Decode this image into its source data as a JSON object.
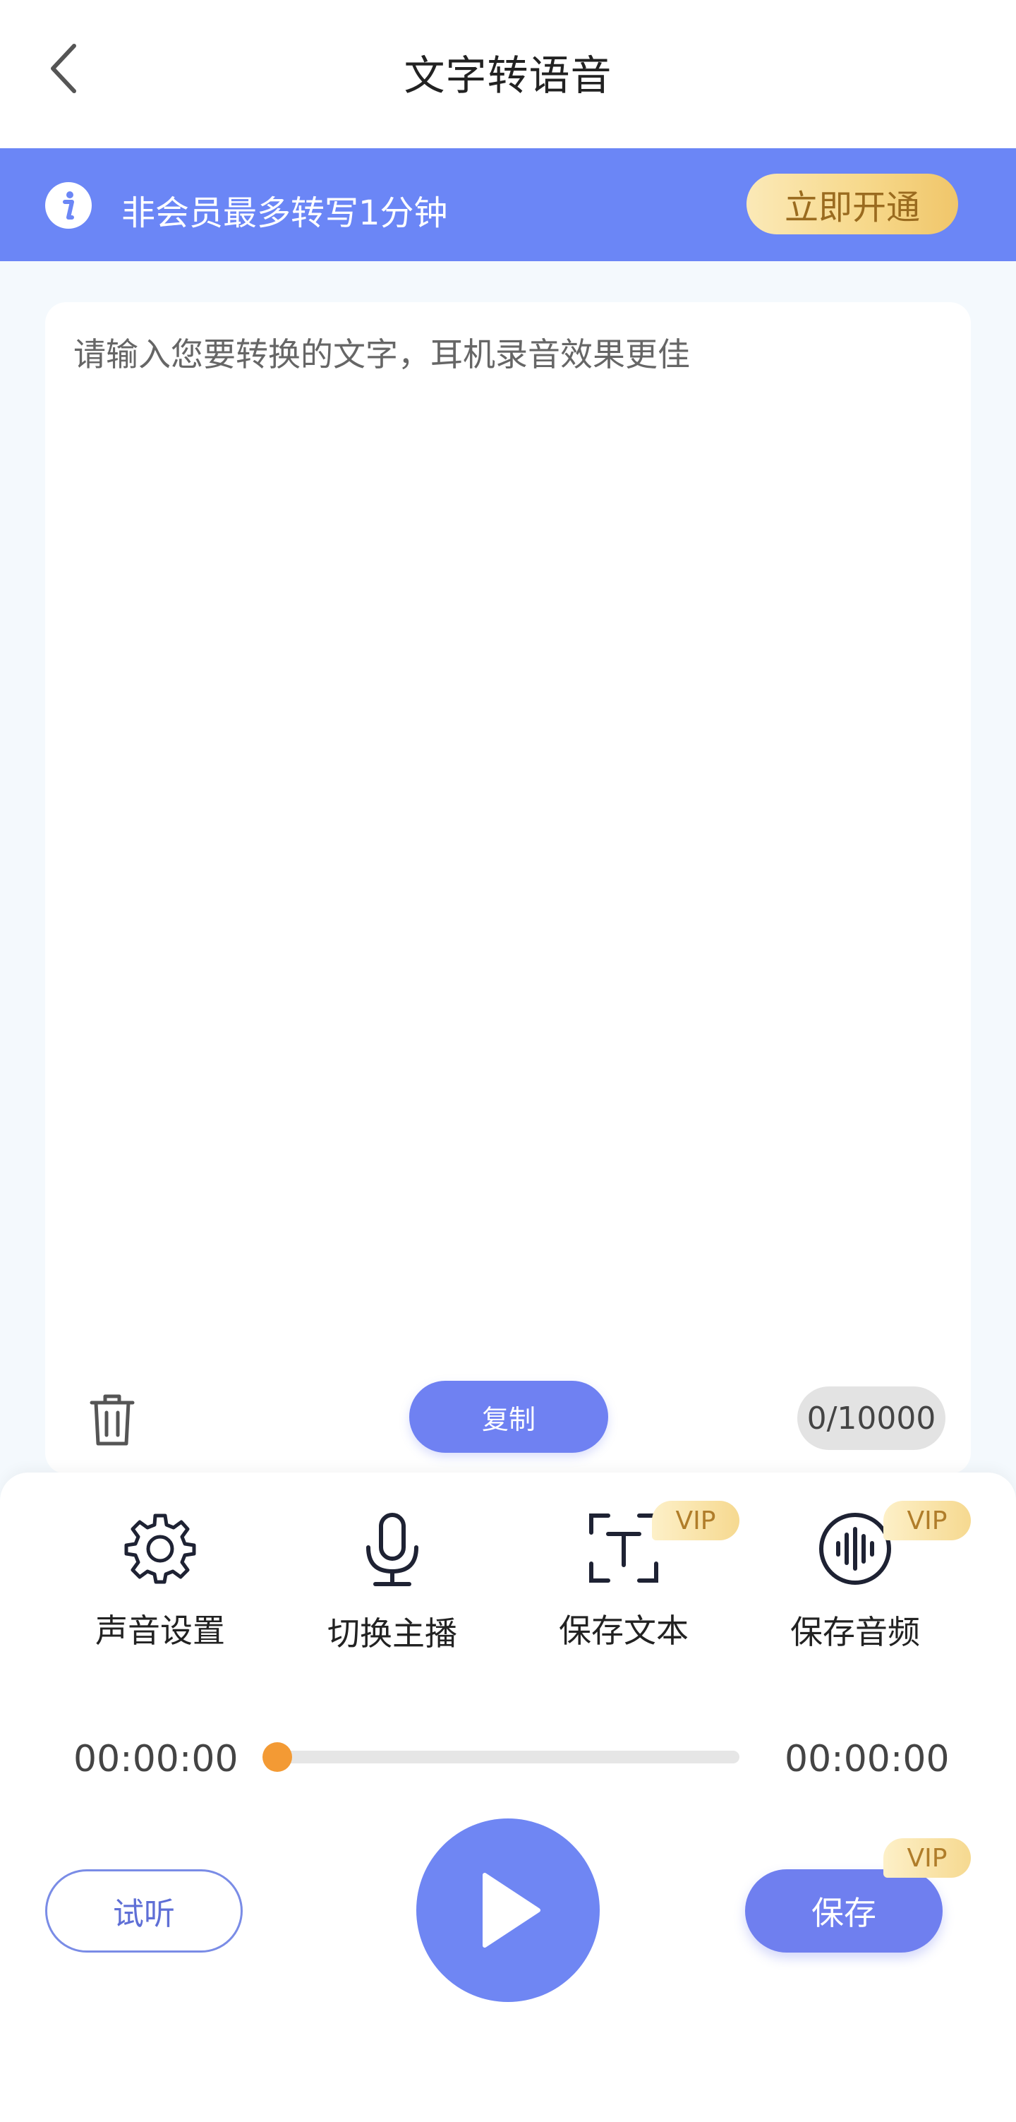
{
  "header": {
    "title": "文字转语音",
    "back_icon": "chevron-left-icon"
  },
  "banner": {
    "icon": "info-icon",
    "message": "非会员最多转写1分钟",
    "cta_label": "立即开通",
    "background_color": "#6b86f6"
  },
  "editor": {
    "value": "",
    "placeholder": "请输入您要转换的文字，耳机录音效果更佳",
    "delete_icon": "trash-icon",
    "copy_label": "复制",
    "char_count": "0/10000"
  },
  "tools": [
    {
      "icon": "gear-icon",
      "label": "声音设置",
      "vip": ""
    },
    {
      "icon": "microphone-icon",
      "label": "切换主播",
      "vip": ""
    },
    {
      "icon": "text-scan-icon",
      "label": "保存文本",
      "vip": "VIP"
    },
    {
      "icon": "audio-wave-icon",
      "label": "保存音频",
      "vip": "VIP"
    }
  ],
  "player": {
    "current_time": "00:00:00",
    "total_time": "00:00:00",
    "progress": 0,
    "thumb_color": "#f39a34",
    "play_icon": "play-icon"
  },
  "actions": {
    "audition_label": "试听",
    "save_label": "保存",
    "save_vip": "VIP",
    "accent_color": "#6f7fef"
  }
}
